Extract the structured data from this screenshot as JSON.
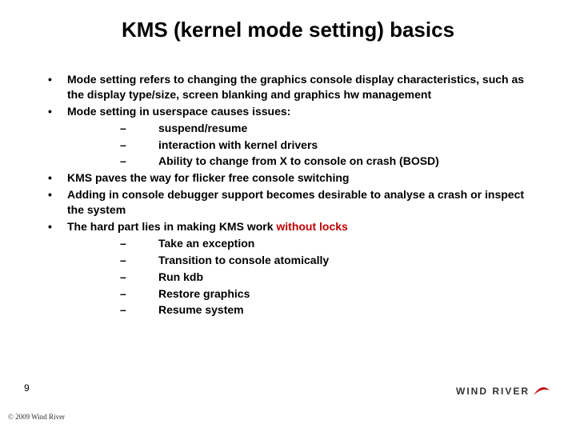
{
  "title": "KMS (kernel mode setting) basics",
  "bullets": {
    "b0": "Mode setting refers to changing the graphics console display characteristics, such as the display type/size, screen blanking and graphics hw management",
    "b1": "Mode setting in userspace causes issues:",
    "b1s0": "suspend/resume",
    "b1s1": "interaction with kernel drivers",
    "b1s2": "Ability to change from X to console on crash (BOSD)",
    "b2": "KMS paves the way for flicker free console switching",
    "b3": "Adding in console debugger support becomes desirable to analyse a crash or inspect the system",
    "b4_pre": "The hard part lies in making KMS work ",
    "b4_hl": "without locks",
    "b4s0": "Take an exception",
    "b4s1": "Transition to console atomically",
    "b4s2": "Run kdb",
    "b4s3": "Restore graphics",
    "b4s4": "Resume system"
  },
  "page_number": "9",
  "copyright": "© 2009 Wind River",
  "logo_text": "WIND RIVER"
}
